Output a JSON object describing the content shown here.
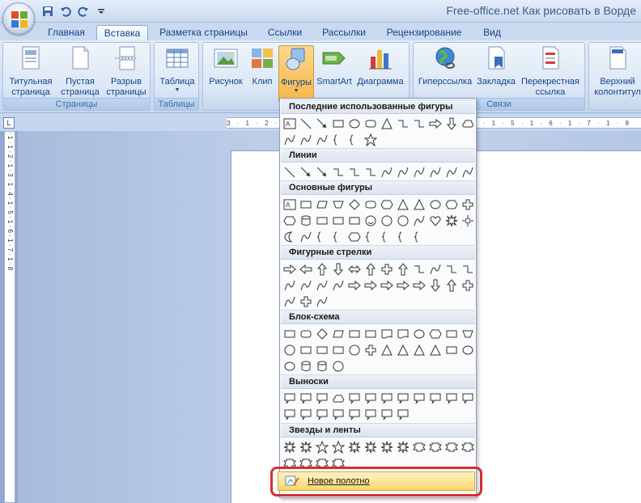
{
  "window": {
    "title": "Free-office.net Как рисовать в Ворде"
  },
  "quick_access": {
    "icons": [
      "save-icon",
      "undo-icon",
      "redo-icon",
      "customize-icon"
    ]
  },
  "tabs": [
    {
      "label": "Главная"
    },
    {
      "label": "Вставка",
      "active": true
    },
    {
      "label": "Разметка страницы"
    },
    {
      "label": "Ссылки"
    },
    {
      "label": "Рассылки"
    },
    {
      "label": "Рецензирование"
    },
    {
      "label": "Вид"
    }
  ],
  "ribbon": {
    "groups": [
      {
        "label": "Страницы",
        "buttons": [
          "Титульная страница",
          "Пустая страница",
          "Разрыв страницы"
        ]
      },
      {
        "label": "Таблицы",
        "buttons": [
          "Таблица"
        ]
      },
      {
        "label": "",
        "buttons": [
          "Рисунок",
          "Клип",
          "Фигуры",
          "SmartArt",
          "Диаграмма"
        ]
      },
      {
        "label": "Связи",
        "buttons": [
          "Гиперссылка",
          "Закладка",
          "Перекрестная ссылка"
        ]
      },
      {
        "label": "",
        "buttons": [
          "Верхний колонтитул"
        ]
      }
    ],
    "btn": {
      "title_page_1": "Титульная",
      "title_page_2": "страница",
      "blank_page_1": "Пустая",
      "blank_page_2": "страница",
      "page_break_1": "Разрыв",
      "page_break_2": "страницы",
      "table": "Таблица",
      "picture": "Рисунок",
      "clip": "Клип",
      "shapes": "Фигуры",
      "smartart": "SmartArt",
      "chart": "Диаграмма",
      "hyperlink": "Гиперссылка",
      "bookmark": "Закладка",
      "crossref_1": "Перекрестная",
      "crossref_2": "ссылка",
      "header_1": "Верхний",
      "header_2": "колонтитул"
    },
    "group_labels": {
      "pages": "Страницы",
      "tables": "Таблицы",
      "links": "Связи"
    }
  },
  "ruler": {
    "text": "3 · 1 · 2 · 1 · 1 · ↕ · · · 1 · 1 · 2 · 1 · 3 · 1 · 4 · 1 · 5 · 1 · 6 · 1 · 7 · 1 · 8",
    "corner": "L"
  },
  "vruler": {
    "text": "· 1 · 1 · 2 · 1 · 3 · 1 · 4 · 1 · 5 · 1 · 6 · 1 · 7 · 1 · 8"
  },
  "shapes_menu": {
    "sections": {
      "recent": "Последние использованные фигуры",
      "lines": "Линии",
      "basic": "Основные фигуры",
      "arrows": "Фигурные стрелки",
      "flowchart": "Блок-схема",
      "callouts": "Выноски",
      "stars": "Звезды и ленты"
    },
    "new_canvas": "Новое полотно"
  },
  "watermark": "FREE-OFFICE.NET",
  "colors": {
    "accent": "#d23030",
    "ribbon": "#dbe7f6",
    "selected": "#fbd56b"
  }
}
